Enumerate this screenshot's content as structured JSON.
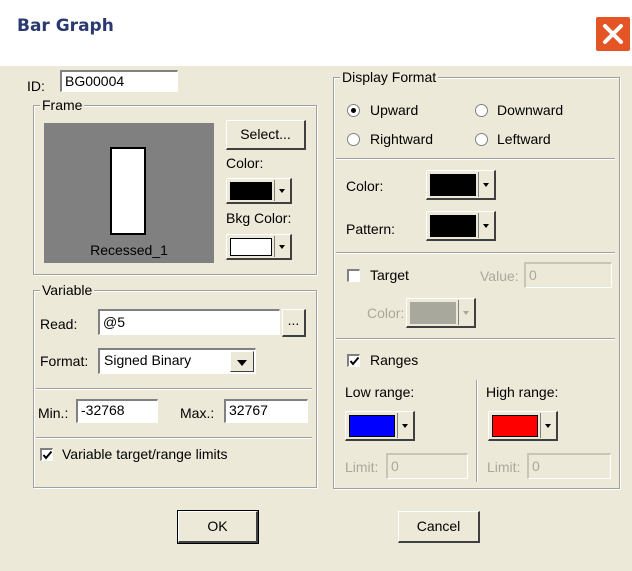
{
  "window": {
    "title": "Bar Graph"
  },
  "id_field": {
    "label": "ID:",
    "value": "BG00004"
  },
  "frame": {
    "group_label": "Frame",
    "select_label": "Select...",
    "color_label": "Color:",
    "bkg_color_label": "Bkg Color:",
    "preview_label": "Recessed_1",
    "color": "#000000",
    "bkg_color": "#ffffff"
  },
  "variable": {
    "group_label": "Variable",
    "read_label": "Read:",
    "read_value": "@5",
    "browse_label": "...",
    "format_label": "Format:",
    "format_value": "Signed Binary",
    "min_label": "Min.:",
    "min_value": "-32768",
    "max_label": "Max.:",
    "max_value": "32767",
    "limits_label": "Variable target/range limits",
    "limits_checked": true
  },
  "display_format": {
    "group_label": "Display Format",
    "options": [
      {
        "label": "Upward",
        "selected": true
      },
      {
        "label": "Downward",
        "selected": false
      },
      {
        "label": "Rightward",
        "selected": false
      },
      {
        "label": "Leftward",
        "selected": false
      }
    ],
    "color_label": "Color:",
    "color": "#000000",
    "pattern_label": "Pattern:",
    "pattern": "#000000"
  },
  "target": {
    "label": "Target",
    "checked": false,
    "value_label": "Value:",
    "value": "0",
    "color_label": "Color:",
    "color": "#a8a89c"
  },
  "ranges": {
    "label": "Ranges",
    "checked": true,
    "low_label": "Low range:",
    "low_color": "#0000ff",
    "low_limit_label": "Limit:",
    "low_limit": "0",
    "high_label": "High range:",
    "high_color": "#ff0000",
    "high_limit_label": "Limit:",
    "high_limit": "0"
  },
  "buttons": {
    "ok": "OK",
    "cancel": "Cancel"
  }
}
